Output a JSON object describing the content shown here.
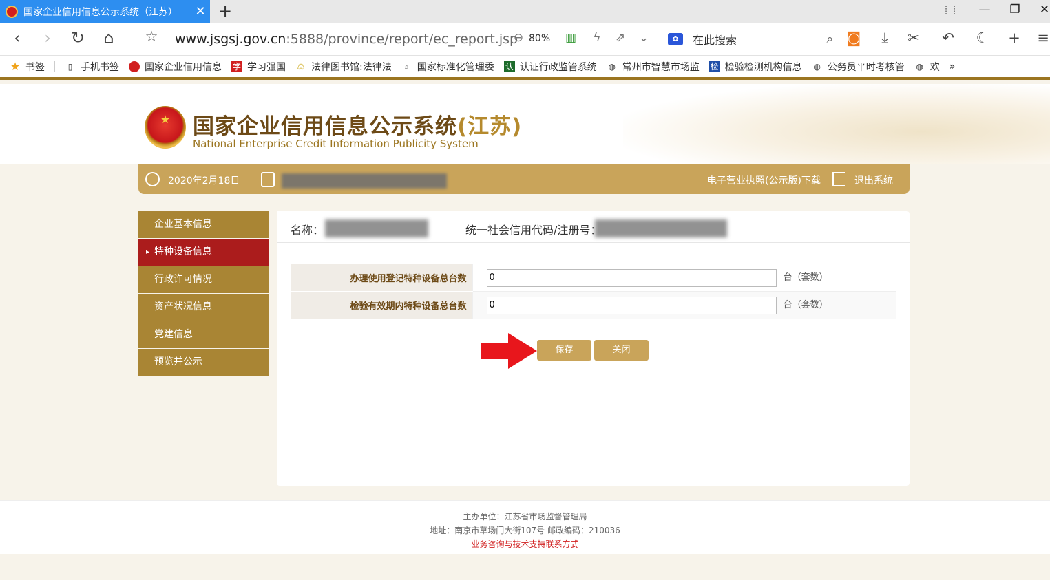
{
  "browser": {
    "tab_title": "国家企业信用信息公示系统（江苏）",
    "tab_close": "✕",
    "new_tab": "+",
    "url_host": "www.jsgsj.gov.cn",
    "url_path": ":5888/province/report/ec_report.jsp",
    "zoom": "80%",
    "search_placeholder": "在此搜索",
    "engine_icon": "paw-icon"
  },
  "bookmarks": [
    {
      "label": "书签"
    },
    {
      "label": "手机书签"
    },
    {
      "label": "国家企业信用信息"
    },
    {
      "label": "学习强国"
    },
    {
      "label": "法律图书馆:法律法"
    },
    {
      "label": "国家标准化管理委"
    },
    {
      "label": "认证行政监管系统"
    },
    {
      "label": "常州市智慧市场监"
    },
    {
      "label": "检验检测机构信息"
    },
    {
      "label": "公务员平时考核管"
    },
    {
      "label": "欢"
    }
  ],
  "bookmarks_more": "»",
  "site": {
    "title_main": "国家企业信用信息公示系统",
    "title_prov": "(江苏)",
    "subtitle": "National Enterprise Credit Information Publicity System"
  },
  "info_bar": {
    "date": "2020年2月18日",
    "username": "您",
    "license_link": "电子营业执照(公示版)下载",
    "exit_link": "退出系统"
  },
  "menu": [
    {
      "label": "企业基本信息",
      "active": false
    },
    {
      "label": "特种设备信息",
      "active": true
    },
    {
      "label": "行政许可情况",
      "active": false
    },
    {
      "label": "资产状况信息",
      "active": false
    },
    {
      "label": "党建信息",
      "active": false
    },
    {
      "label": "预览并公示",
      "active": false
    }
  ],
  "panel": {
    "name_label": "名称：",
    "name_value": "厂",
    "code_label": "统一社会信用代码/注册号：",
    "code_value": "92"
  },
  "form": [
    {
      "label": "办理使用登记特种设备总台数",
      "value": "0",
      "unit": "台（套数）"
    },
    {
      "label": "检验有效期内特种设备总台数",
      "value": "0",
      "unit": "台（套数）"
    }
  ],
  "buttons": {
    "save": "保存",
    "close": "关闭"
  },
  "footer": {
    "sponsor": "主办单位：江苏省市场监督管理局",
    "address": "地址：南京市草场门大街107号    邮政编码：210036",
    "contact": "业务咨询与技术支持联系方式"
  },
  "colors": {
    "accent": "#c9a45a",
    "menu": "#a98534",
    "active": "#ab1c1c",
    "tab": "#2d8ef0"
  }
}
